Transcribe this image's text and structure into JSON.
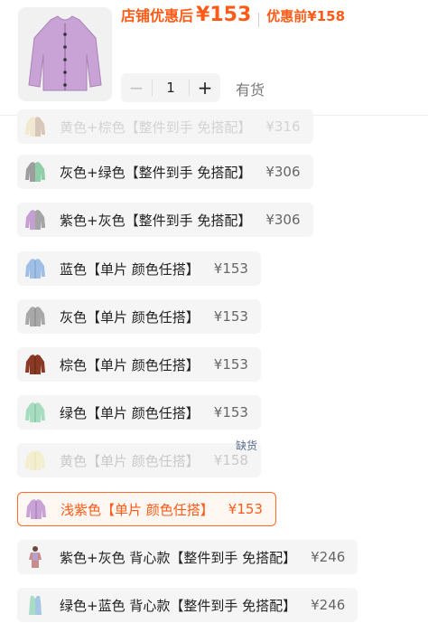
{
  "header": {
    "price_label": "店铺优惠后",
    "price_value": "¥153",
    "original_label": "优惠前",
    "original_value": "¥158",
    "image_icon": "cardigan-thumbnail",
    "accent_color": "#ff5b17"
  },
  "quantity": {
    "minus": "−",
    "value": "1",
    "plus": "+"
  },
  "stock_status": "有货",
  "sku_options": [
    {
      "label": "黄色+棕色【整件到手 免搭配】",
      "price": "¥316",
      "state": "faded",
      "icon": "yellow-brown-cardigan-icon"
    },
    {
      "label": "灰色+绿色【整件到手 免搭配】",
      "price": "¥306",
      "state": "normal",
      "icon": "gray-green-cardigan-icon"
    },
    {
      "label": "紫色+灰色【整件到手 免搭配】",
      "price": "¥306",
      "state": "normal",
      "icon": "purple-gray-cardigan-icon"
    },
    {
      "label": "蓝色【单片 颜色任搭】",
      "price": "¥153",
      "state": "normal",
      "icon": "blue-cardigan-icon"
    },
    {
      "label": "灰色【单片 颜色任搭】",
      "price": "¥153",
      "state": "normal",
      "icon": "gray-cardigan-icon"
    },
    {
      "label": "棕色【单片 颜色任搭】",
      "price": "¥153",
      "state": "normal",
      "icon": "brown-cardigan-icon"
    },
    {
      "label": "绿色【单片 颜色任搭】",
      "price": "¥153",
      "state": "normal",
      "icon": "green-cardigan-icon"
    },
    {
      "label": "黄色【单片 颜色任搭】",
      "price": "¥158",
      "state": "disabled",
      "icon": "yellow-cardigan-icon"
    },
    {
      "label": "浅紫色【单片 颜色任搭】",
      "price": "¥153",
      "state": "selected",
      "icon": "light-purple-cardigan-icon"
    },
    {
      "label": "紫色+灰色 背心款【整件到手 免搭配】",
      "price": "¥246",
      "state": "normal",
      "icon": "purple-gray-vest-model-icon"
    },
    {
      "label": "绿色+蓝色 背心款【整件到手 免搭配】",
      "price": "¥246",
      "state": "normal",
      "icon": "green-blue-vest-icon"
    }
  ],
  "out_of_stock_label": "缺货"
}
